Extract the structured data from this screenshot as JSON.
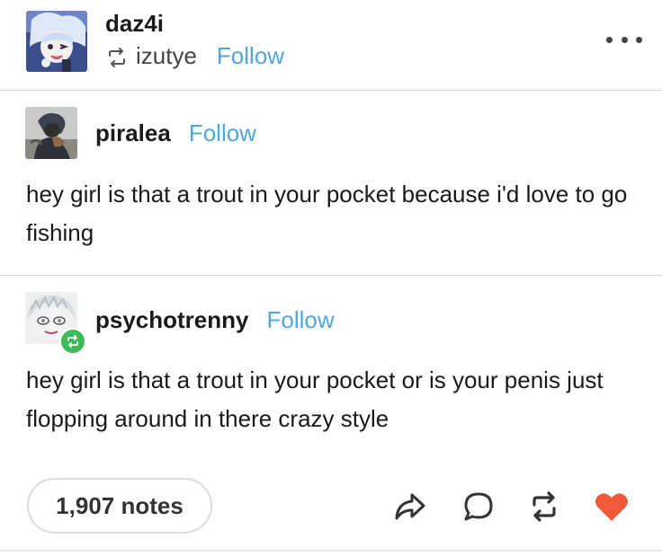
{
  "header": {
    "blog_name": "daz4i",
    "reblogged_from": "izutye",
    "follow_label": "Follow",
    "more_icon": "more-dots-icon"
  },
  "trail": [
    {
      "blog_name": "piralea",
      "follow_label": "Follow",
      "text": "hey girl is that a trout in your pocket because i'd love to go fishing"
    },
    {
      "blog_name": "psychotrenny",
      "follow_label": "Follow",
      "text": "hey girl is that a trout in your pocket or is your penis just flopping around in there crazy style"
    }
  ],
  "footer": {
    "notes_label": "1,907 notes",
    "icons": [
      "share-icon",
      "reply-icon",
      "reblog-icon",
      "like-icon"
    ]
  },
  "colors": {
    "follow": "#4da7e0",
    "like": "#f05a3a",
    "reblog_badge": "#3dbb5a",
    "divider": "#d4d4d4"
  }
}
